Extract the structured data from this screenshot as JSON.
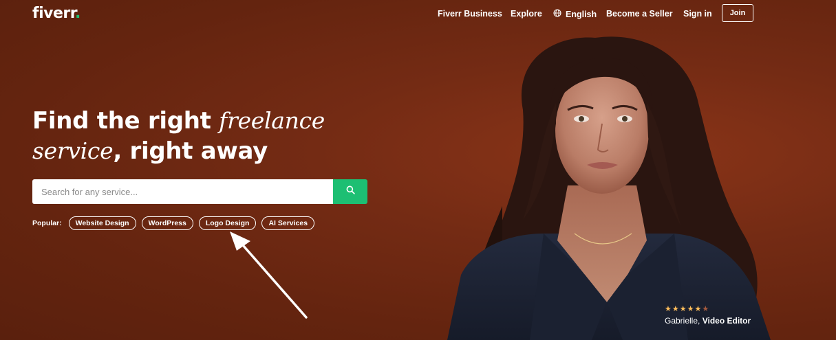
{
  "nav": {
    "logo": "fiverr",
    "logo_dot": ".",
    "items": {
      "business": "Fiverr Business",
      "explore": "Explore",
      "language": "English",
      "become_seller": "Become a Seller",
      "sign_in": "Sign in",
      "join": "Join"
    }
  },
  "hero": {
    "line1_plain": "Find the right ",
    "line1_serif": "freelance",
    "line2_serif": "service",
    "line2_plain": ", right away"
  },
  "search": {
    "placeholder": "Search for any service...",
    "icon": "search-icon"
  },
  "popular": {
    "label": "Popular:",
    "chips": [
      "Website Design",
      "WordPress",
      "Logo Design",
      "AI Services"
    ]
  },
  "testimonial": {
    "rating": 5,
    "stars": "★★★★★",
    "name": "Gabrielle, ",
    "role": "Video Editor"
  },
  "colors": {
    "background": "#742b14",
    "accent": "#1dbf73",
    "star": "#ffbe5b"
  }
}
